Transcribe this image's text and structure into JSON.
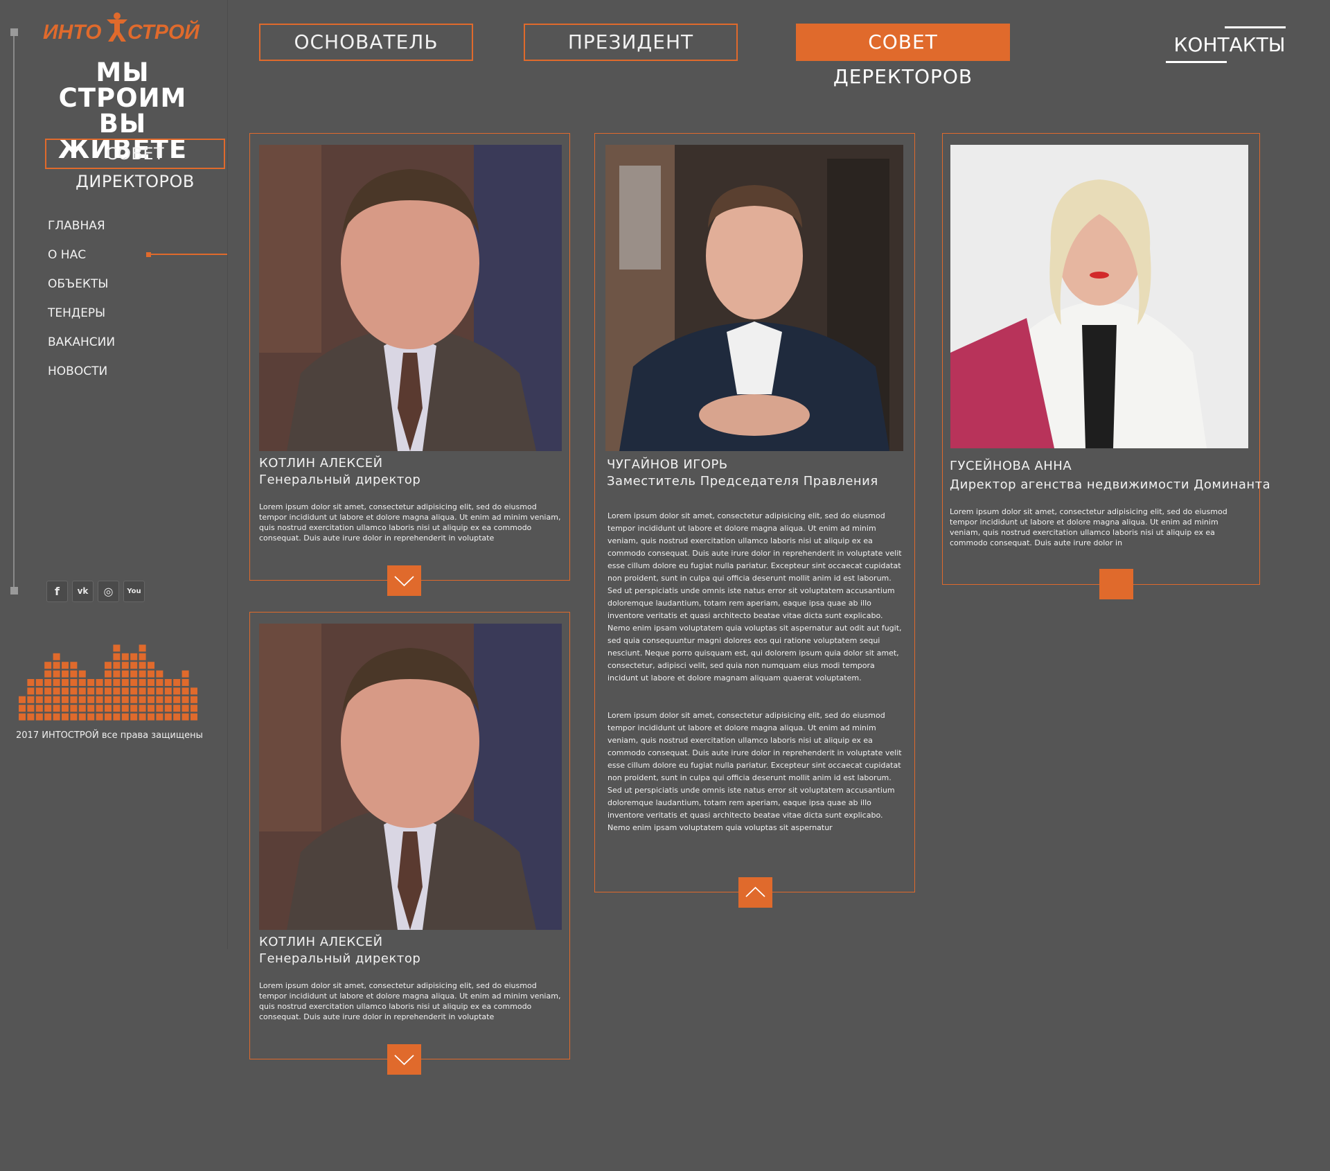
{
  "brand": {
    "logo_left": "ИНТО",
    "logo_right": "СТРОЙ",
    "slogan_line1": "МЫ СТРОИМ",
    "slogan_line2": "ВЫ ЖИВЕТЕ",
    "accent_color": "#e06a2c"
  },
  "sidebar": {
    "section_button": "СОВЕТ ДИРЕКТОРОВ",
    "nav": [
      {
        "label": "ГЛАВНАЯ",
        "active": false
      },
      {
        "label": "О НАС",
        "active": true
      },
      {
        "label": "ОБЪЕКТЫ",
        "active": false
      },
      {
        "label": "ТЕНДЕРЫ",
        "active": false
      },
      {
        "label": "ВАКАНСИИ",
        "active": false
      },
      {
        "label": "НОВОСТИ",
        "active": false
      }
    ],
    "social": [
      {
        "icon": "facebook-icon",
        "glyph": "f"
      },
      {
        "icon": "vk-icon",
        "glyph": "vk"
      },
      {
        "icon": "instagram-icon",
        "glyph": "◎"
      },
      {
        "icon": "youtube-icon",
        "glyph": "You"
      }
    ],
    "copyright": "2017 ИНТОСТРОЙ все права защищены"
  },
  "topnav": {
    "tabs": [
      {
        "label": "ОСНОВАТЕЛЬ",
        "active": false
      },
      {
        "label": "ПРЕЗИДЕНТ",
        "active": false
      },
      {
        "label": "СОВЕТ ДЕРЕКТОРОВ",
        "active": true
      }
    ],
    "contacts": "КОНТАКТЫ"
  },
  "cards": [
    {
      "name": "КОТЛИН АЛЕКСЕЙ",
      "role": "Генеральный директор",
      "text": "Lorem ipsum dolor sit amet, consectetur adipisicing elit, sed do eiusmod tempor incididunt ut labore et dolore magna aliqua. Ut enim ad minim veniam, quis nostrud exercitation ullamco laboris nisi ut aliquip ex ea commodo consequat. Duis aute irure dolor in reprehenderit in voluptate",
      "toggle": "chevron-down-icon"
    },
    {
      "name": "ЧУГАЙНОВ ИГОРЬ",
      "role": "Заместитель Председателя Правления",
      "text": "Lorem ipsum dolor sit amet, consectetur adipisicing elit, sed do eiusmod tempor incididunt ut labore et dolore magna aliqua. Ut enim ad minim veniam, quis nostrud exercitation ullamco laboris nisi ut aliquip ex ea commodo consequat. Duis aute irure dolor in reprehenderit in voluptate velit esse cillum dolore eu fugiat nulla pariatur. Excepteur sint occaecat cupidatat non proident, sunt in culpa qui officia deserunt mollit anim id est laborum. Sed ut perspiciatis unde omnis iste natus error sit voluptatem accusantium doloremque laudantium, totam rem aperiam, eaque ipsa quae ab illo inventore veritatis et quasi architecto beatae vitae dicta sunt explicabo. Nemo enim ipsam voluptatem quia voluptas sit aspernatur aut odit aut fugit, sed quia consequuntur magni dolores eos qui ratione voluptatem sequi nesciunt. Neque porro quisquam est, qui dolorem ipsum quia dolor sit amet, consectetur, adipisci velit, sed quia non numquam eius modi tempora incidunt ut labore et dolore magnam aliquam quaerat voluptatem.",
      "text2": "Lorem ipsum dolor sit amet, consectetur adipisicing elit, sed do eiusmod tempor incididunt ut labore et dolore magna aliqua. Ut enim ad minim veniam, quis nostrud exercitation ullamco laboris nisi ut aliquip ex ea commodo consequat. Duis aute irure dolor in reprehenderit in voluptate velit esse cillum dolore eu fugiat nulla pariatur. Excepteur sint occaecat cupidatat non proident, sunt in culpa qui officia deserunt mollit anim id est laborum. Sed ut perspiciatis unde omnis iste natus error sit voluptatem accusantium doloremque laudantium, totam rem aperiam, eaque ipsa quae ab illo inventore veritatis et quasi architecto beatae vitae dicta sunt explicabo. Nemo enim ipsam voluptatem quia voluptas sit aspernatur",
      "toggle": "chevron-up-icon"
    },
    {
      "name": "ГУСЕЙНОВА АННА",
      "role": "Директор агенства недвижимости Доминанта",
      "text": "Lorem ipsum dolor sit amet, consectetur adipisicing elit, sed do eiusmod tempor incididunt ut labore et dolore magna aliqua. Ut enim ad minim veniam, quis nostrud exercitation ullamco laboris nisi ut aliquip ex ea commodo consequat. Duis aute irure dolor in",
      "toggle": "blank"
    },
    {
      "name": "КОТЛИН АЛЕКСЕЙ",
      "role": "Генеральный директор",
      "text": "Lorem ipsum dolor sit amet, consectetur adipisicing elit, sed do eiusmod tempor incididunt ut labore et dolore magna aliqua. Ut enim ad minim veniam, quis nostrud exercitation ullamco laboris nisi ut aliquip ex ea commodo consequat. Duis aute irure dolor in reprehenderit in voluptate",
      "toggle": "chevron-down-icon"
    }
  ]
}
